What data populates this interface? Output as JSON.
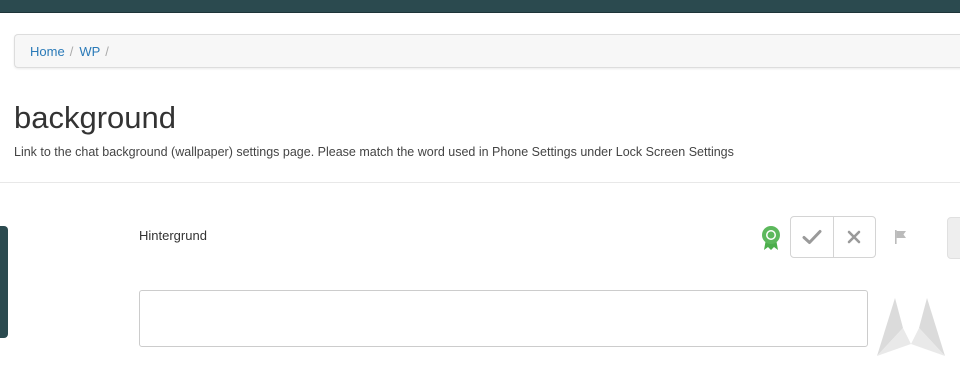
{
  "breadcrumb": {
    "home_label": "Home",
    "separator": "/",
    "wp_label": "WP"
  },
  "string": {
    "key": "background",
    "description": "Link to the chat background (wallpaper) settings page. Please match the word used in Phone Settings under Lock Screen Settings"
  },
  "suggestion": {
    "text": "Hintergrund",
    "status": "approved",
    "approve_icon": "checkmark-icon",
    "reject_icon": "close-icon",
    "flag_icon": "flag-icon",
    "status_icon": "ribbon-award-icon"
  },
  "translation_input": {
    "value": "",
    "placeholder": ""
  },
  "colors": {
    "topbar": "#2b4a4f",
    "link": "#2a7ab8",
    "approved": "#5cb85c"
  }
}
